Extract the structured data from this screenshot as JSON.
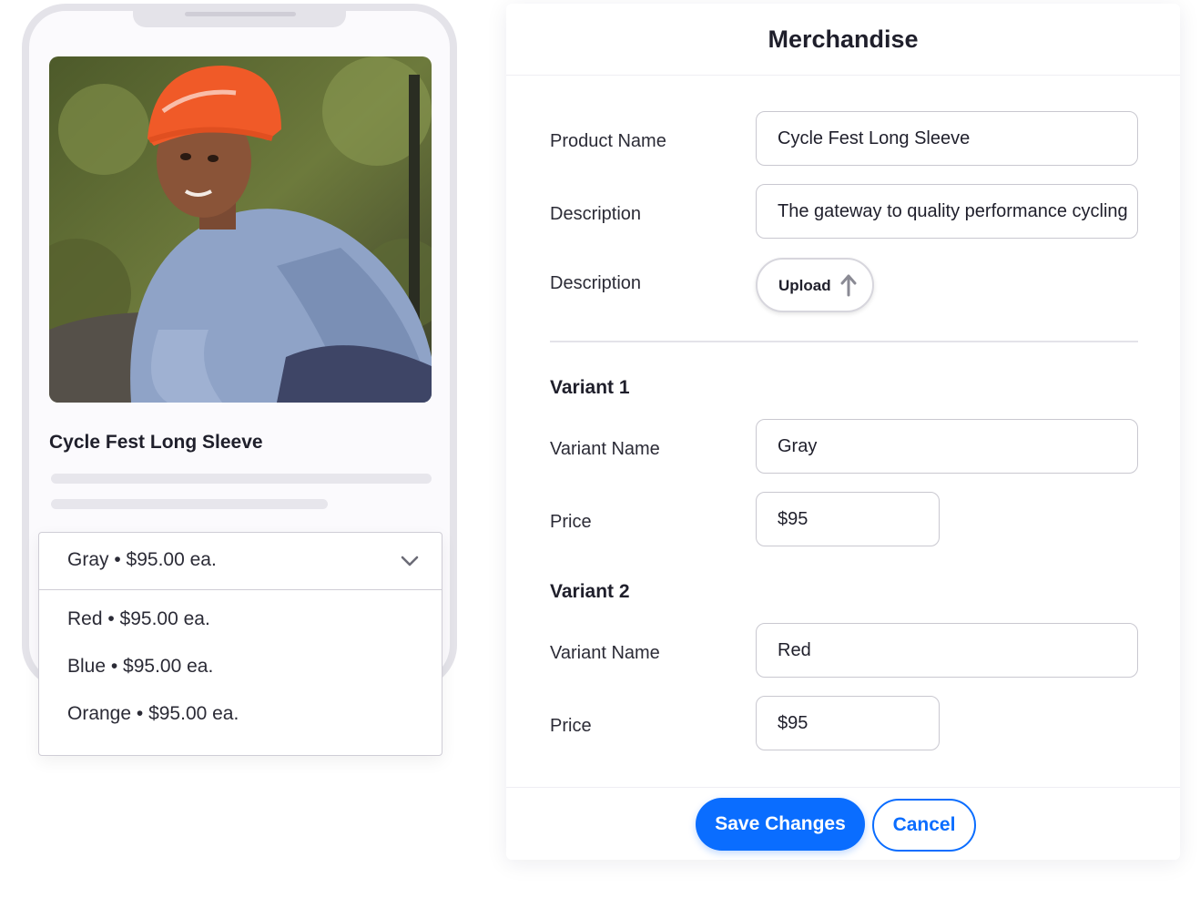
{
  "phone": {
    "product_title": "Cycle Fest Long Sleeve",
    "dropdown": {
      "selected": "Gray  •  $95.00 ea.",
      "options": [
        "Red  •  $95.00 ea.",
        "Blue  •  $95.00 ea.",
        "Orange  •  $95.00 ea."
      ]
    }
  },
  "form": {
    "title": "Merchandise",
    "product_name": {
      "label": "Product Name",
      "value": "Cycle Fest Long Sleeve"
    },
    "description": {
      "label": "Description",
      "value": "The gateway to quality performance cycling"
    },
    "image": {
      "label": "Description",
      "button": "Upload",
      "icon": "arrow-up-icon"
    },
    "variants": [
      {
        "heading": "Variant 1",
        "name_label": "Variant Name",
        "name_value": "Gray",
        "price_label": "Price",
        "price_value": "$95"
      },
      {
        "heading": "Variant 2",
        "name_label": "Variant Name",
        "name_value": "Red",
        "price_label": "Price",
        "price_value": "$95"
      }
    ],
    "save_label": "Save Changes",
    "cancel_label": "Cancel"
  },
  "colors": {
    "accent": "#0a6dff",
    "helmet": "#f05a28",
    "jersey": "#8fa3c7"
  }
}
